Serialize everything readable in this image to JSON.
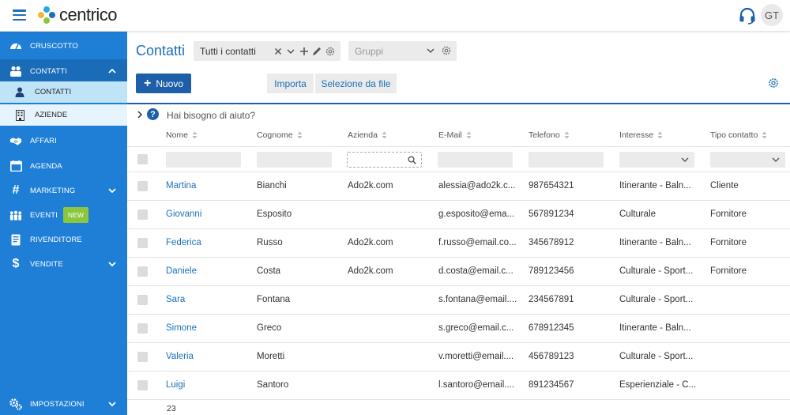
{
  "brand": {
    "name": "centrico"
  },
  "user": {
    "initials": "GT"
  },
  "colors": {
    "primary": "#1f7fd6",
    "dark_blue": "#1d5fa8",
    "new_badge": "#8cc63f",
    "link": "#1d6fb8"
  },
  "sidebar": {
    "items": [
      {
        "key": "cruscotto",
        "label": "CRUSCOTTO",
        "icon": "dashboard-icon"
      },
      {
        "key": "contatti",
        "label": "CONTATTI",
        "icon": "people-icon",
        "expanded": true
      },
      {
        "key": "affari",
        "label": "AFFARI",
        "icon": "handshake-icon"
      },
      {
        "key": "agenda",
        "label": "AGENDA",
        "icon": "calendar-icon"
      },
      {
        "key": "marketing",
        "label": "MARKETING",
        "icon": "hashtag-icon"
      },
      {
        "key": "eventi",
        "label": "EVENTI",
        "icon": "crowd-icon",
        "badge": "NEW"
      },
      {
        "key": "rivenditore",
        "label": "RIVENDITORE",
        "icon": "id-card-icon"
      },
      {
        "key": "vendite",
        "label": "VENDITE",
        "icon": "dollar-icon"
      },
      {
        "key": "impostazioni",
        "label": "IMPOSTAZIONI",
        "icon": "cogs-icon"
      }
    ],
    "sub_items": [
      {
        "label": "CONTATTI",
        "icon": "person-icon",
        "active": true
      },
      {
        "label": "AZIENDE",
        "icon": "building-icon",
        "active": false
      }
    ]
  },
  "header": {
    "title": "Contatti",
    "view_select": "Tutti i contatti",
    "groups_placeholder": "Gruppi"
  },
  "toolbar": {
    "new_label": "Nuovo",
    "import_label": "Importa",
    "from_file_label": "Selezione da file"
  },
  "help": {
    "text": "Hai bisogno di aiuto?"
  },
  "table": {
    "columns": [
      "Nome",
      "Cognome",
      "Azienda",
      "E-Mail",
      "Telefono",
      "Interesse",
      "Tipo contatto"
    ],
    "rows": [
      {
        "nome": "Martina",
        "cognome": "Bianchi",
        "azienda": "Ado2k.com",
        "email": "alessia@ado2k.c...",
        "telefono": "987654321",
        "interesse": "Itinerante - Baln...",
        "tipo": "Cliente"
      },
      {
        "nome": "Giovanni",
        "cognome": "Esposito",
        "azienda": "",
        "email": "g.esposito@ema...",
        "telefono": "567891234",
        "interesse": "Culturale",
        "tipo": "Fornitore"
      },
      {
        "nome": "Federica",
        "cognome": "Russo",
        "azienda": "Ado2k.com",
        "email": "f.russo@email.co...",
        "telefono": "345678912",
        "interesse": "Itinerante - Baln...",
        "tipo": "Fornitore"
      },
      {
        "nome": "Daniele",
        "cognome": "Costa",
        "azienda": "Ado2k.com",
        "email": "d.costa@email.c...",
        "telefono": "789123456",
        "interesse": "Culturale - Sport...",
        "tipo": "Fornitore"
      },
      {
        "nome": "Sara",
        "cognome": "Fontana",
        "azienda": "",
        "email": "s.fontana@email....",
        "telefono": "234567891",
        "interesse": "Culturale - Sport...",
        "tipo": ""
      },
      {
        "nome": "Simone",
        "cognome": "Greco",
        "azienda": "",
        "email": "s.greco@email.c...",
        "telefono": "678912345",
        "interesse": "Itinerante - Baln...",
        "tipo": ""
      },
      {
        "nome": "Valeria",
        "cognome": "Moretti",
        "azienda": "",
        "email": "v.moretti@email....",
        "telefono": "456789123",
        "interesse": "Culturale - Sport...",
        "tipo": ""
      },
      {
        "nome": "Luigi",
        "cognome": "Santoro",
        "azienda": "",
        "email": "l.santoro@email....",
        "telefono": "891234567",
        "interesse": "Esperienziale - C...",
        "tipo": ""
      }
    ],
    "total_count": "23"
  }
}
